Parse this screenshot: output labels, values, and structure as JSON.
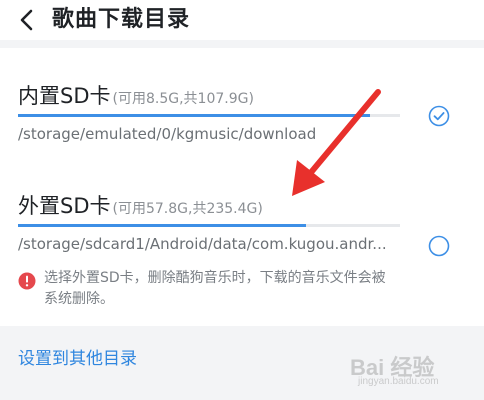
{
  "header": {
    "title": "歌曲下载目录",
    "back_icon": "chevron-left-icon"
  },
  "storage_options": [
    {
      "name": "内置SD卡",
      "capacity": "(可用8.5G,共107.9G)",
      "path": "/storage/emulated/0/kgmusic/download",
      "used_fraction": 0.921,
      "selected": true
    },
    {
      "name": "外置SD卡",
      "capacity": "(可用57.8G,共235.4G)",
      "path": "/storage/sdcard1/Android/data/com.kugou.andr...",
      "used_fraction": 0.754,
      "selected": false,
      "warning": "选择外置SD卡，删除酷狗音乐时，下载的音乐文件会被系统删除。"
    }
  ],
  "other_dir_label": "设置到其他目录",
  "watermark": {
    "main": "Bai 经验",
    "sub": "jingyan.baidu.com"
  },
  "colors": {
    "accent": "#3d8fe6",
    "link": "#2f86df",
    "warning": "#e5484d",
    "annotation_arrow": "#e8302c"
  }
}
